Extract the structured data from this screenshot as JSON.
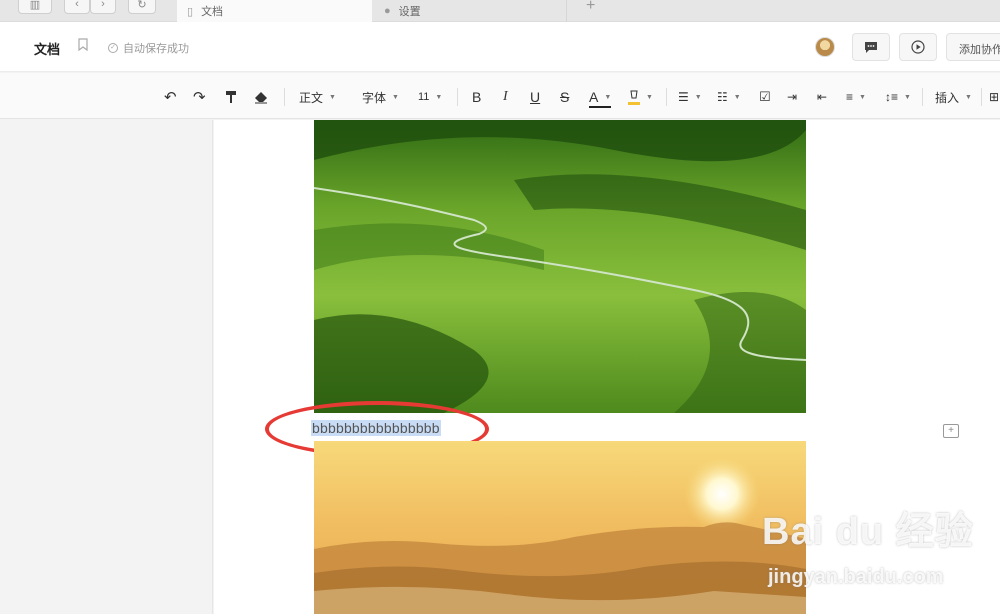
{
  "tabs": [
    {
      "label": "文档",
      "active": true,
      "icon": "document-icon"
    },
    {
      "label": "设置",
      "active": false,
      "icon": "settings-icon"
    }
  ],
  "header": {
    "doc_title": "文档",
    "save_status": "自动保存成功",
    "collab_label": "添加协作"
  },
  "toolbar": {
    "style_select": "正文",
    "font_select": "字体",
    "size_select": "11",
    "bold": "B",
    "italic": "I",
    "underline": "U",
    "strike": "S",
    "font_color": "A",
    "insert_label": "插入"
  },
  "document": {
    "selected_text": "bbbbbbbbbbbbbbbb"
  },
  "watermark": {
    "brand": "Bai du 经验",
    "url": "jingyan.baidu.com"
  },
  "colors": {
    "selection": "#c9dcf5",
    "annotation_red": "#e63a34"
  }
}
